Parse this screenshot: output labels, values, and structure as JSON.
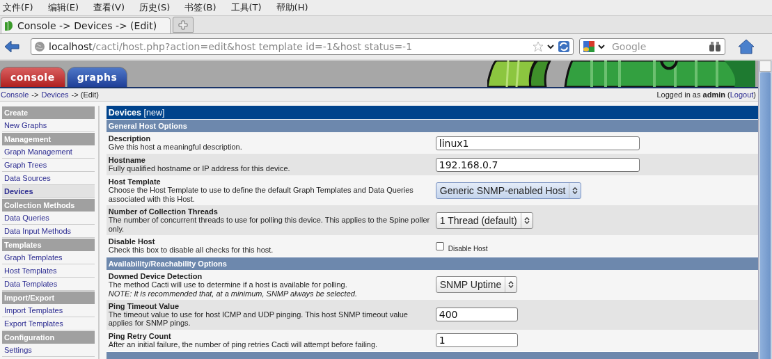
{
  "menu": [
    "文件(F)",
    "编辑(E)",
    "查看(V)",
    "历史(S)",
    "书签(B)",
    "工具(T)",
    "帮助(H)"
  ],
  "browser_tabs": [
    {
      "title": "Console -> Devices -> (Edit)",
      "selected": true
    }
  ],
  "address": {
    "host": "localhost",
    "path": "/cacti/host.php?action=edit&host template id=-1&host status=-1"
  },
  "search": {
    "placeholder": "Google"
  },
  "app_tabs": [
    {
      "label": "console",
      "selected": true
    },
    {
      "label": "graphs",
      "selected": false
    }
  ],
  "breadcrumb": [
    {
      "kind": "link",
      "text": "Console"
    },
    {
      "kind": "text",
      "text": "->"
    },
    {
      "kind": "link",
      "text": "Devices"
    },
    {
      "kind": "text",
      "text": "-> (Edit)"
    }
  ],
  "login": {
    "prefix": "Logged in as",
    "user": "admin",
    "open": "(",
    "logout": "Logout",
    "close": ")"
  },
  "sidebar": [
    {
      "kind": "header",
      "label": "Create"
    },
    {
      "kind": "item",
      "label": "New Graphs",
      "selected": false
    },
    {
      "kind": "header",
      "label": "Management"
    },
    {
      "kind": "item",
      "label": "Graph Management",
      "selected": false
    },
    {
      "kind": "item",
      "label": "Graph Trees",
      "selected": false
    },
    {
      "kind": "item",
      "label": "Data Sources",
      "selected": false
    },
    {
      "kind": "item",
      "label": "Devices",
      "selected": true
    },
    {
      "kind": "header",
      "label": "Collection Methods"
    },
    {
      "kind": "item",
      "label": "Data Queries",
      "selected": false
    },
    {
      "kind": "item",
      "label": "Data Input Methods",
      "selected": false
    },
    {
      "kind": "header",
      "label": "Templates"
    },
    {
      "kind": "item",
      "label": "Graph Templates",
      "selected": false
    },
    {
      "kind": "item",
      "label": "Host Templates",
      "selected": false
    },
    {
      "kind": "item",
      "label": "Data Templates",
      "selected": false
    },
    {
      "kind": "header",
      "label": "Import/Export"
    },
    {
      "kind": "item",
      "label": "Import Templates",
      "selected": false
    },
    {
      "kind": "item",
      "label": "Export Templates",
      "selected": false
    },
    {
      "kind": "header",
      "label": "Configuration"
    },
    {
      "kind": "item",
      "label": "Settings",
      "selected": false
    }
  ],
  "panel_title": {
    "title": "Devices",
    "suffix": "[new]"
  },
  "sections": [
    {
      "title": "General Host Options",
      "rows": [
        {
          "label": "Description",
          "description": "Give this host a meaningful description.",
          "control": {
            "kind": "text",
            "value": "linux1"
          }
        },
        {
          "label": "Hostname",
          "description": "Fully qualified hostname or IP address for this device.",
          "control": {
            "kind": "text",
            "value": "192.168.0.7"
          }
        },
        {
          "label": "Host Template",
          "description": "Choose the Host Template to use to define the default Graph Templates and Data Queries associated with this Host.",
          "control": {
            "kind": "select",
            "value": "Generic SNMP-enabled Host",
            "focused": true
          }
        },
        {
          "label": "Number of Collection Threads",
          "description": "The number of concurrent threads to use for polling this device. This applies to the Spine poller only.",
          "control": {
            "kind": "select",
            "value": "1 Thread (default)",
            "focused": false
          }
        },
        {
          "label": "Disable Host",
          "description": "Check this box to disable all checks for this host.",
          "control": {
            "kind": "checkbox",
            "checked": false,
            "label": "Disable Host"
          }
        }
      ]
    },
    {
      "title": "Availability/Reachability Options",
      "rows": [
        {
          "label": "Downed Device Detection",
          "description": "The method Cacti will use to determine if a host is available for polling.",
          "note": "NOTE: It is recommended that, at a minimum, SNMP always be selected.",
          "control": {
            "kind": "select",
            "value": "SNMP Uptime",
            "focused": false
          }
        },
        {
          "label": "Ping Timeout Value",
          "description": "The timeout value to use for host ICMP and UDP pinging. This host SNMP timeout value applies for SNMP pings.",
          "control": {
            "kind": "number",
            "value": "400"
          }
        },
        {
          "label": "Ping Retry Count",
          "description": "After an initial failure, the number of ping retries Cacti will attempt before failing.",
          "control": {
            "kind": "number",
            "value": "1"
          }
        }
      ]
    }
  ]
}
